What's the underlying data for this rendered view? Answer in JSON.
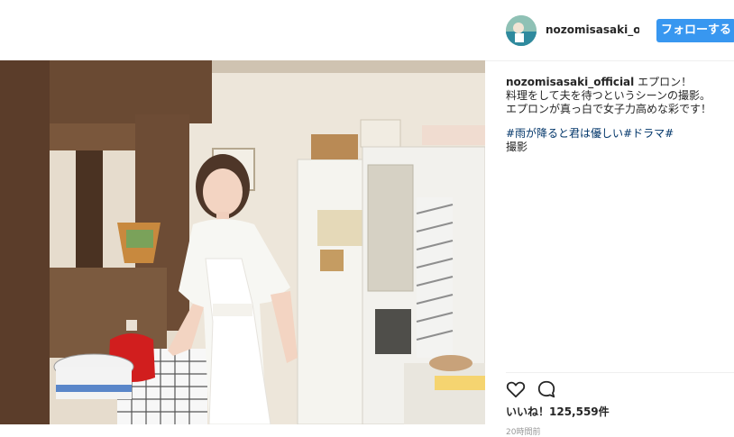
{
  "header": {
    "username": "nozomisasaki_offici",
    "follow_label": "フォローする"
  },
  "caption": {
    "username": "nozomisasaki_official",
    "line1": "エプロン！",
    "line2": "料理をして夫を待つというシーンの撮影。",
    "line3": "エプロンが真っ白で女子力高めな彩です！",
    "hashtag1": "#雨が降ると君は優しい",
    "hashtag2": "#ドラマ",
    "hashtag3": "#",
    "line5": "撮影"
  },
  "actions": {
    "like_icon": "heart-icon",
    "comment_icon": "comment-icon"
  },
  "likes": {
    "label": "いいね！125,559件"
  },
  "timestamp": "20時間前",
  "colors": {
    "accent": "#3897f0",
    "hashtag": "#003569"
  }
}
